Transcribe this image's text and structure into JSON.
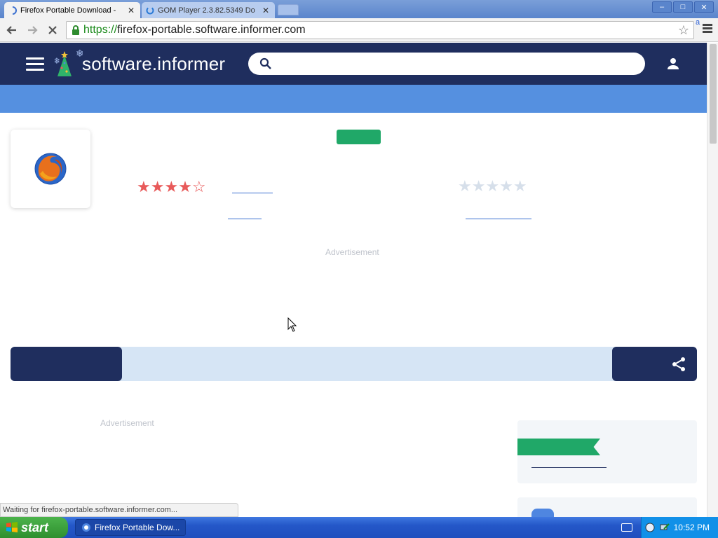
{
  "browser": {
    "tabs": [
      {
        "title": "Firefox Portable Download -",
        "active": true,
        "close": "✕"
      },
      {
        "title": "GOM Player 2.3.82.5349 Do",
        "active": false,
        "close": "✕"
      }
    ],
    "window_buttons": [
      "–",
      "□",
      "✕"
    ],
    "address": {
      "scheme": "https://",
      "host": "firefox-portable.software.informer.com"
    },
    "extension_badge": "a",
    "status_text": "Waiting for firefox-portable.software.informer.com..."
  },
  "site": {
    "logo_text": "software.informer",
    "search_placeholder": "",
    "icons": [
      "hamburger-icon",
      "search-icon",
      "user-icon",
      "share-icon"
    ],
    "colors": {
      "header": "#1f2e5e",
      "subbar": "#5590e0",
      "green": "#20a868",
      "star_red": "#e85a5a",
      "star_grey": "#d6dfea"
    }
  },
  "app": {
    "user_rating_stars": "★★★★☆",
    "editor_rating_stars": "★★★★★",
    "user_rating": 4,
    "editor_rating": 0
  },
  "ads": {
    "label_top": "Advertisement",
    "label_left": "Advertisement"
  },
  "taskbar": {
    "start_label": "start",
    "task_title": "Firefox Portable Dow...",
    "clock": "10:52 PM"
  }
}
